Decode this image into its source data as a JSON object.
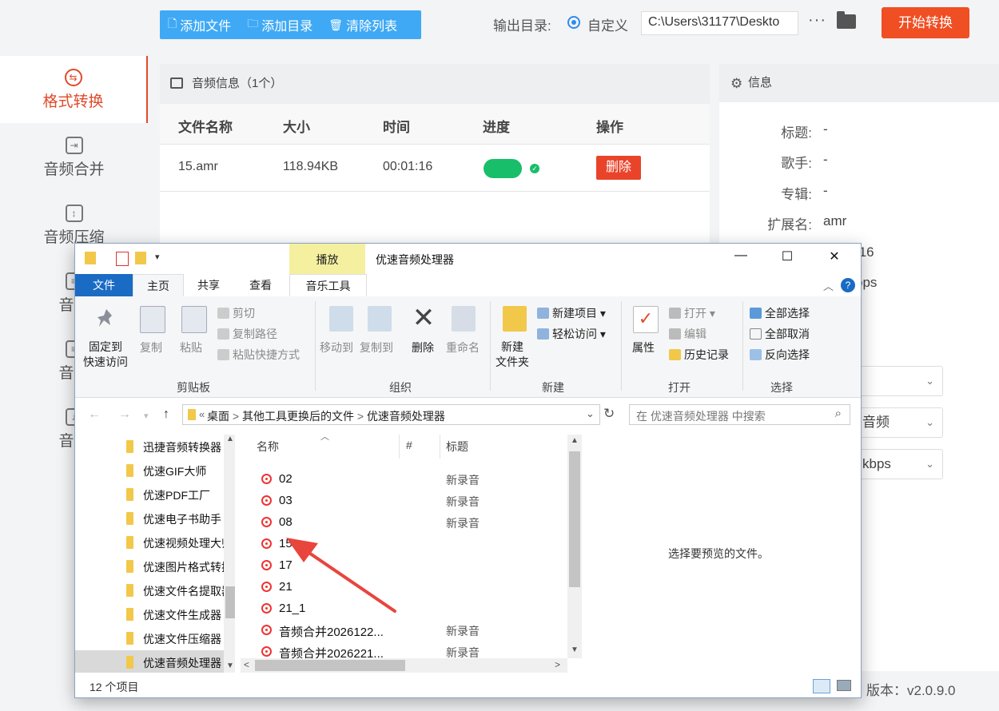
{
  "sidebar": {
    "items": [
      {
        "label": "格式转换",
        "icon": "convert-icon",
        "active": true
      },
      {
        "label": "音频合并",
        "icon": "merge-icon"
      },
      {
        "label": "音频压缩",
        "icon": "compress-icon"
      },
      {
        "label": "音频",
        "icon": "split-icon"
      },
      {
        "label": "音频",
        "icon": "cut-icon"
      },
      {
        "label": "音量",
        "icon": "volume-icon"
      }
    ]
  },
  "toolbar": {
    "add_file": "添加文件",
    "add_dir": "添加目录",
    "clear_list": "清除列表",
    "output_dir_label": "输出目录:",
    "custom_radio": "自定义",
    "output_path": "C:\\Users\\31177\\Deskto",
    "more": "···",
    "start": "开始转换"
  },
  "audio_panel": {
    "title": "音频信息（1个）",
    "columns": {
      "name": "文件名称",
      "size": "大小",
      "time": "时间",
      "progress": "进度",
      "action": "操作"
    },
    "rows": [
      {
        "name": "15.amr",
        "size": "118.94KB",
        "time": "00:01:16",
        "progress": 1.0,
        "action": "删除"
      }
    ]
  },
  "info_panel": {
    "title": "信息",
    "fields": [
      {
        "label": "标题:",
        "value": "-"
      },
      {
        "label": "歌手:",
        "value": "-"
      },
      {
        "label": "专辑:",
        "value": "-"
      },
      {
        "label": "扩展名:",
        "value": "amr"
      }
    ],
    "partial_values": {
      "duration_tail": ":16",
      "bitrate_tail": "bps"
    },
    "selects": [
      "",
      "音频",
      "kbps"
    ]
  },
  "footer": {
    "version": "版本：v2.0.9.0"
  },
  "explorer": {
    "title": "优速音频处理器",
    "context_tab": "播放",
    "tabs": [
      "文件",
      "主页",
      "共享",
      "查看",
      "音乐工具"
    ],
    "ribbon": {
      "clipboard": {
        "group": "剪贴板",
        "pin": "固定到\n快速访问",
        "copy": "复制",
        "paste": "粘贴",
        "cut": "剪切",
        "copy_path": "复制路径",
        "paste_shortcut": "粘贴快捷方式"
      },
      "organize": {
        "group": "组织",
        "move_to": "移动到",
        "copy_to": "复制到",
        "delete": "删除",
        "rename": "重命名"
      },
      "new": {
        "group": "新建",
        "new_folder": "新建\n文件夹",
        "new_item": "新建项目",
        "easy_access": "轻松访问"
      },
      "open": {
        "group": "打开",
        "properties": "属性",
        "open": "打开",
        "edit": "编辑",
        "history": "历史记录"
      },
      "select": {
        "group": "选择",
        "select_all": "全部选择",
        "select_none": "全部取消",
        "invert": "反向选择"
      }
    },
    "address": {
      "crumbs": [
        "桌面",
        "其他工具更换后的文件",
        "优速音频处理器"
      ]
    },
    "search_placeholder": "在 优速音频处理器 中搜索",
    "nav_items": [
      "迅捷音频转换器",
      "优速GIF大师",
      "优速PDF工厂",
      "优速电子书助手",
      "优速视频处理大师",
      "优速图片格式转换器",
      "优速文件名提取器",
      "优速文件生成器",
      "优速文件压缩器",
      "优速音频处理器"
    ],
    "columns": {
      "name": "名称",
      "num": "#",
      "title": "标题"
    },
    "files": [
      {
        "name": "02",
        "title": "新录音"
      },
      {
        "name": "03",
        "title": "新录音"
      },
      {
        "name": "08",
        "title": "新录音"
      },
      {
        "name": "15",
        "title": ""
      },
      {
        "name": "17",
        "title": ""
      },
      {
        "name": "21",
        "title": ""
      },
      {
        "name": "21_1",
        "title": ""
      },
      {
        "name": "音频合并2026122...",
        "title": "新录音"
      },
      {
        "name": "音频合并2026221...",
        "title": "新录音"
      }
    ],
    "preview_text": "选择要预览的文件。",
    "status": "12 个项目"
  },
  "colors": {
    "accent": "#f04e23",
    "blue": "#3fa9f5",
    "green": "#19be6b",
    "annotation_arrow": "#e8453c"
  }
}
